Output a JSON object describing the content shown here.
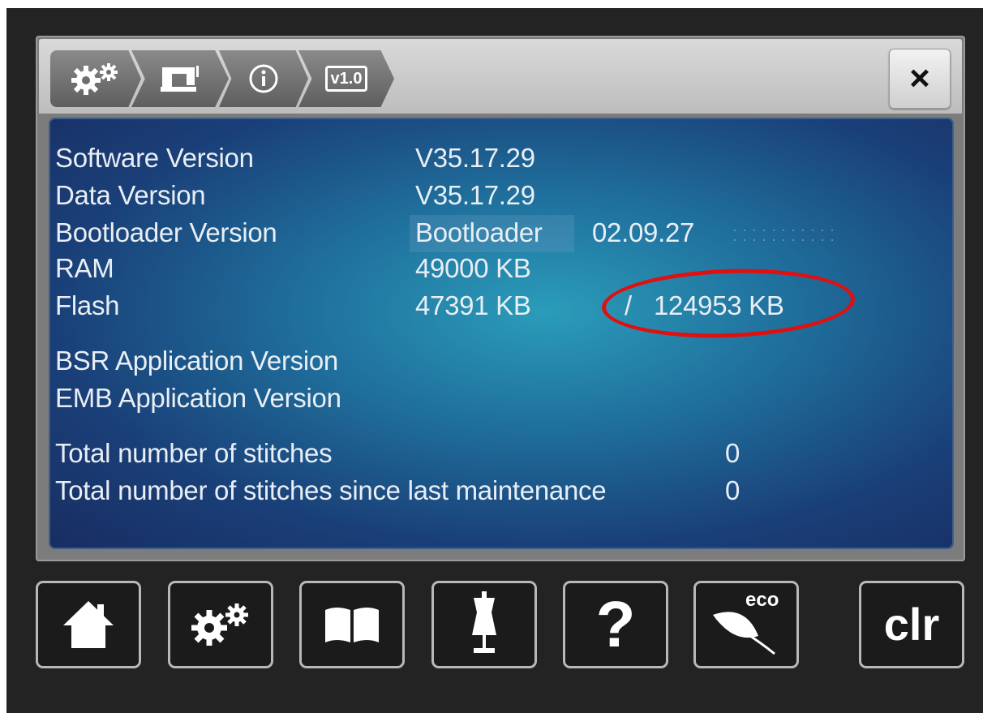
{
  "breadcrumb": [
    {
      "icon": "gears-icon"
    },
    {
      "icon": "sewing-machine-icon"
    },
    {
      "icon": "info-icon"
    },
    {
      "icon": "version-icon",
      "label": "v1.0"
    }
  ],
  "close_button": {
    "icon": "close-icon",
    "label": "×"
  },
  "info": {
    "software_version": {
      "label": "Software Version",
      "value": "V35.17.29"
    },
    "data_version": {
      "label": "Data Version",
      "value": "V35.17.29"
    },
    "bootloader_version": {
      "label": "Bootloader Version",
      "value_name": "Bootloader",
      "value": "02.09.27"
    },
    "ram": {
      "label": "RAM",
      "value": "49000 KB"
    },
    "flash": {
      "label": "Flash",
      "value": "47391 KB",
      "separator": "/",
      "total": "124953 KB"
    },
    "bsr_version": {
      "label": "BSR Application Version"
    },
    "emb_version": {
      "label": "EMB Application Version"
    },
    "total_stitches": {
      "label": "Total number of stitches",
      "value": "0"
    },
    "stitches_since_maintenance": {
      "label": "Total number of stitches since last maintenance",
      "value": "0"
    }
  },
  "bottom_buttons": [
    {
      "icon": "home-icon"
    },
    {
      "icon": "gears-icon"
    },
    {
      "icon": "book-icon"
    },
    {
      "icon": "dress-form-icon"
    },
    {
      "icon": "help-icon",
      "label": "?"
    },
    {
      "icon": "eco-leaf-icon",
      "label": "eco"
    },
    {
      "icon": "clear-icon",
      "label": "clr"
    }
  ],
  "colors": {
    "annotation_circle": "#e01010",
    "text": "#e9eef4",
    "content_background": "#1f6f9c"
  }
}
